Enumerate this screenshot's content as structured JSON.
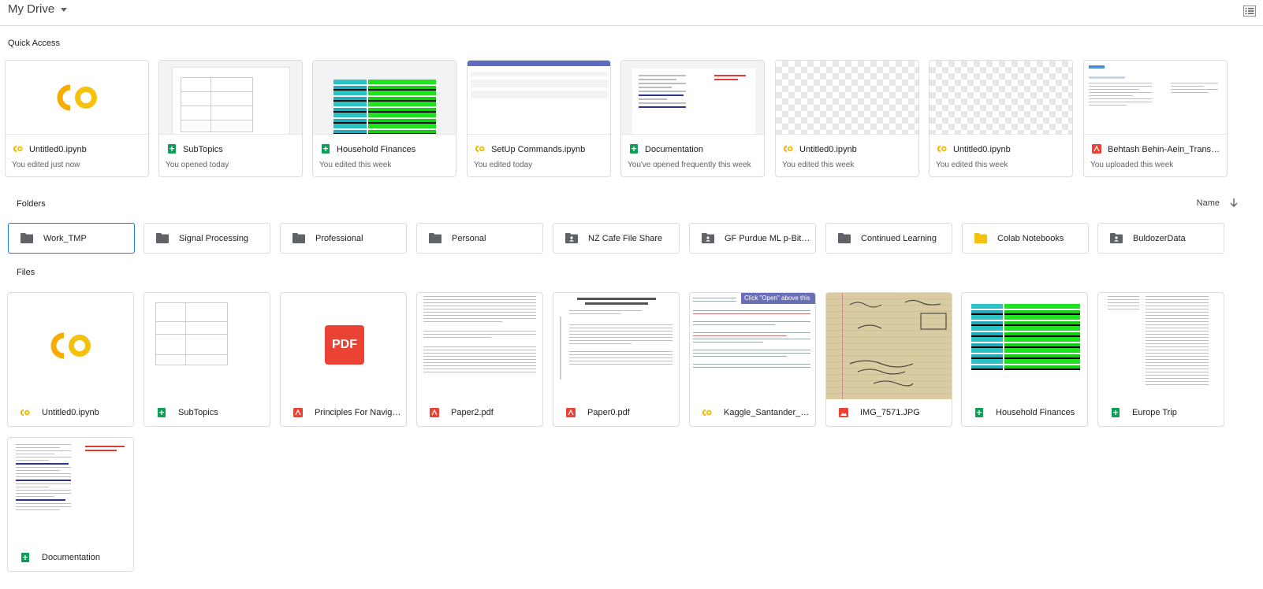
{
  "header": {
    "title": "My Drive",
    "view_icon": "list-view-icon"
  },
  "quick_access": {
    "label": "Quick Access",
    "items": [
      {
        "name": "Untitled0.ipynb",
        "sub": "You edited just now",
        "type": "colab"
      },
      {
        "name": "SubTopics",
        "sub": "You opened today",
        "type": "sheets"
      },
      {
        "name": "Household Finances",
        "sub": "You edited this week",
        "type": "sheets"
      },
      {
        "name": "SetUp Commands.ipynb",
        "sub": "You edited today",
        "type": "colab"
      },
      {
        "name": "Documentation",
        "sub": "You've opened frequently this week",
        "type": "sheets"
      },
      {
        "name": "Untitled0.ipynb",
        "sub": "You edited this week",
        "type": "colab"
      },
      {
        "name": "Untitled0.ipynb",
        "sub": "You edited this week",
        "type": "colab"
      },
      {
        "name": "Behtash Behin-Aein_TransU...",
        "sub": "You uploaded this week",
        "type": "pdf"
      }
    ]
  },
  "folders": {
    "label": "Folders",
    "sort_label": "Name",
    "items": [
      {
        "name": "Work_TMP",
        "kind": "folder",
        "selected": true
      },
      {
        "name": "Signal Processing",
        "kind": "folder"
      },
      {
        "name": "Professional",
        "kind": "folder"
      },
      {
        "name": "Personal",
        "kind": "folder"
      },
      {
        "name": "NZ Cafe File Share",
        "kind": "shared"
      },
      {
        "name": "GF Purdue ML p-Bits ...",
        "kind": "shared"
      },
      {
        "name": "Continued Learning",
        "kind": "folder"
      },
      {
        "name": "Colab Notebooks",
        "kind": "colab-folder"
      },
      {
        "name": "BuldozerData",
        "kind": "shared"
      }
    ]
  },
  "files": {
    "label": "Files",
    "items": [
      {
        "name": "Untitled0.ipynb",
        "type": "colab"
      },
      {
        "name": "SubTopics",
        "type": "sheets"
      },
      {
        "name": "Principles For Navigat...",
        "type": "pdf",
        "badge": "PDF"
      },
      {
        "name": "Paper2.pdf",
        "type": "pdf"
      },
      {
        "name": "Paper0.pdf",
        "type": "pdf"
      },
      {
        "name": "Kaggle_Santander_Bo...",
        "type": "colab",
        "banner": "Click \"Open\" above this"
      },
      {
        "name": "IMG_7571.JPG",
        "type": "image"
      },
      {
        "name": "Household Finances",
        "type": "sheets"
      },
      {
        "name": "Europe Trip",
        "type": "sheets"
      },
      {
        "name": "Documentation",
        "type": "sheets"
      }
    ]
  },
  "colors": {
    "colab_orange": "#F9AB00",
    "colab_yellow": "#F4C20D",
    "sheets_green": "#0F9D58",
    "pdf_red": "#EA4335",
    "selected_blue": "#1A73E8",
    "folder_grey": "#5F6368"
  }
}
